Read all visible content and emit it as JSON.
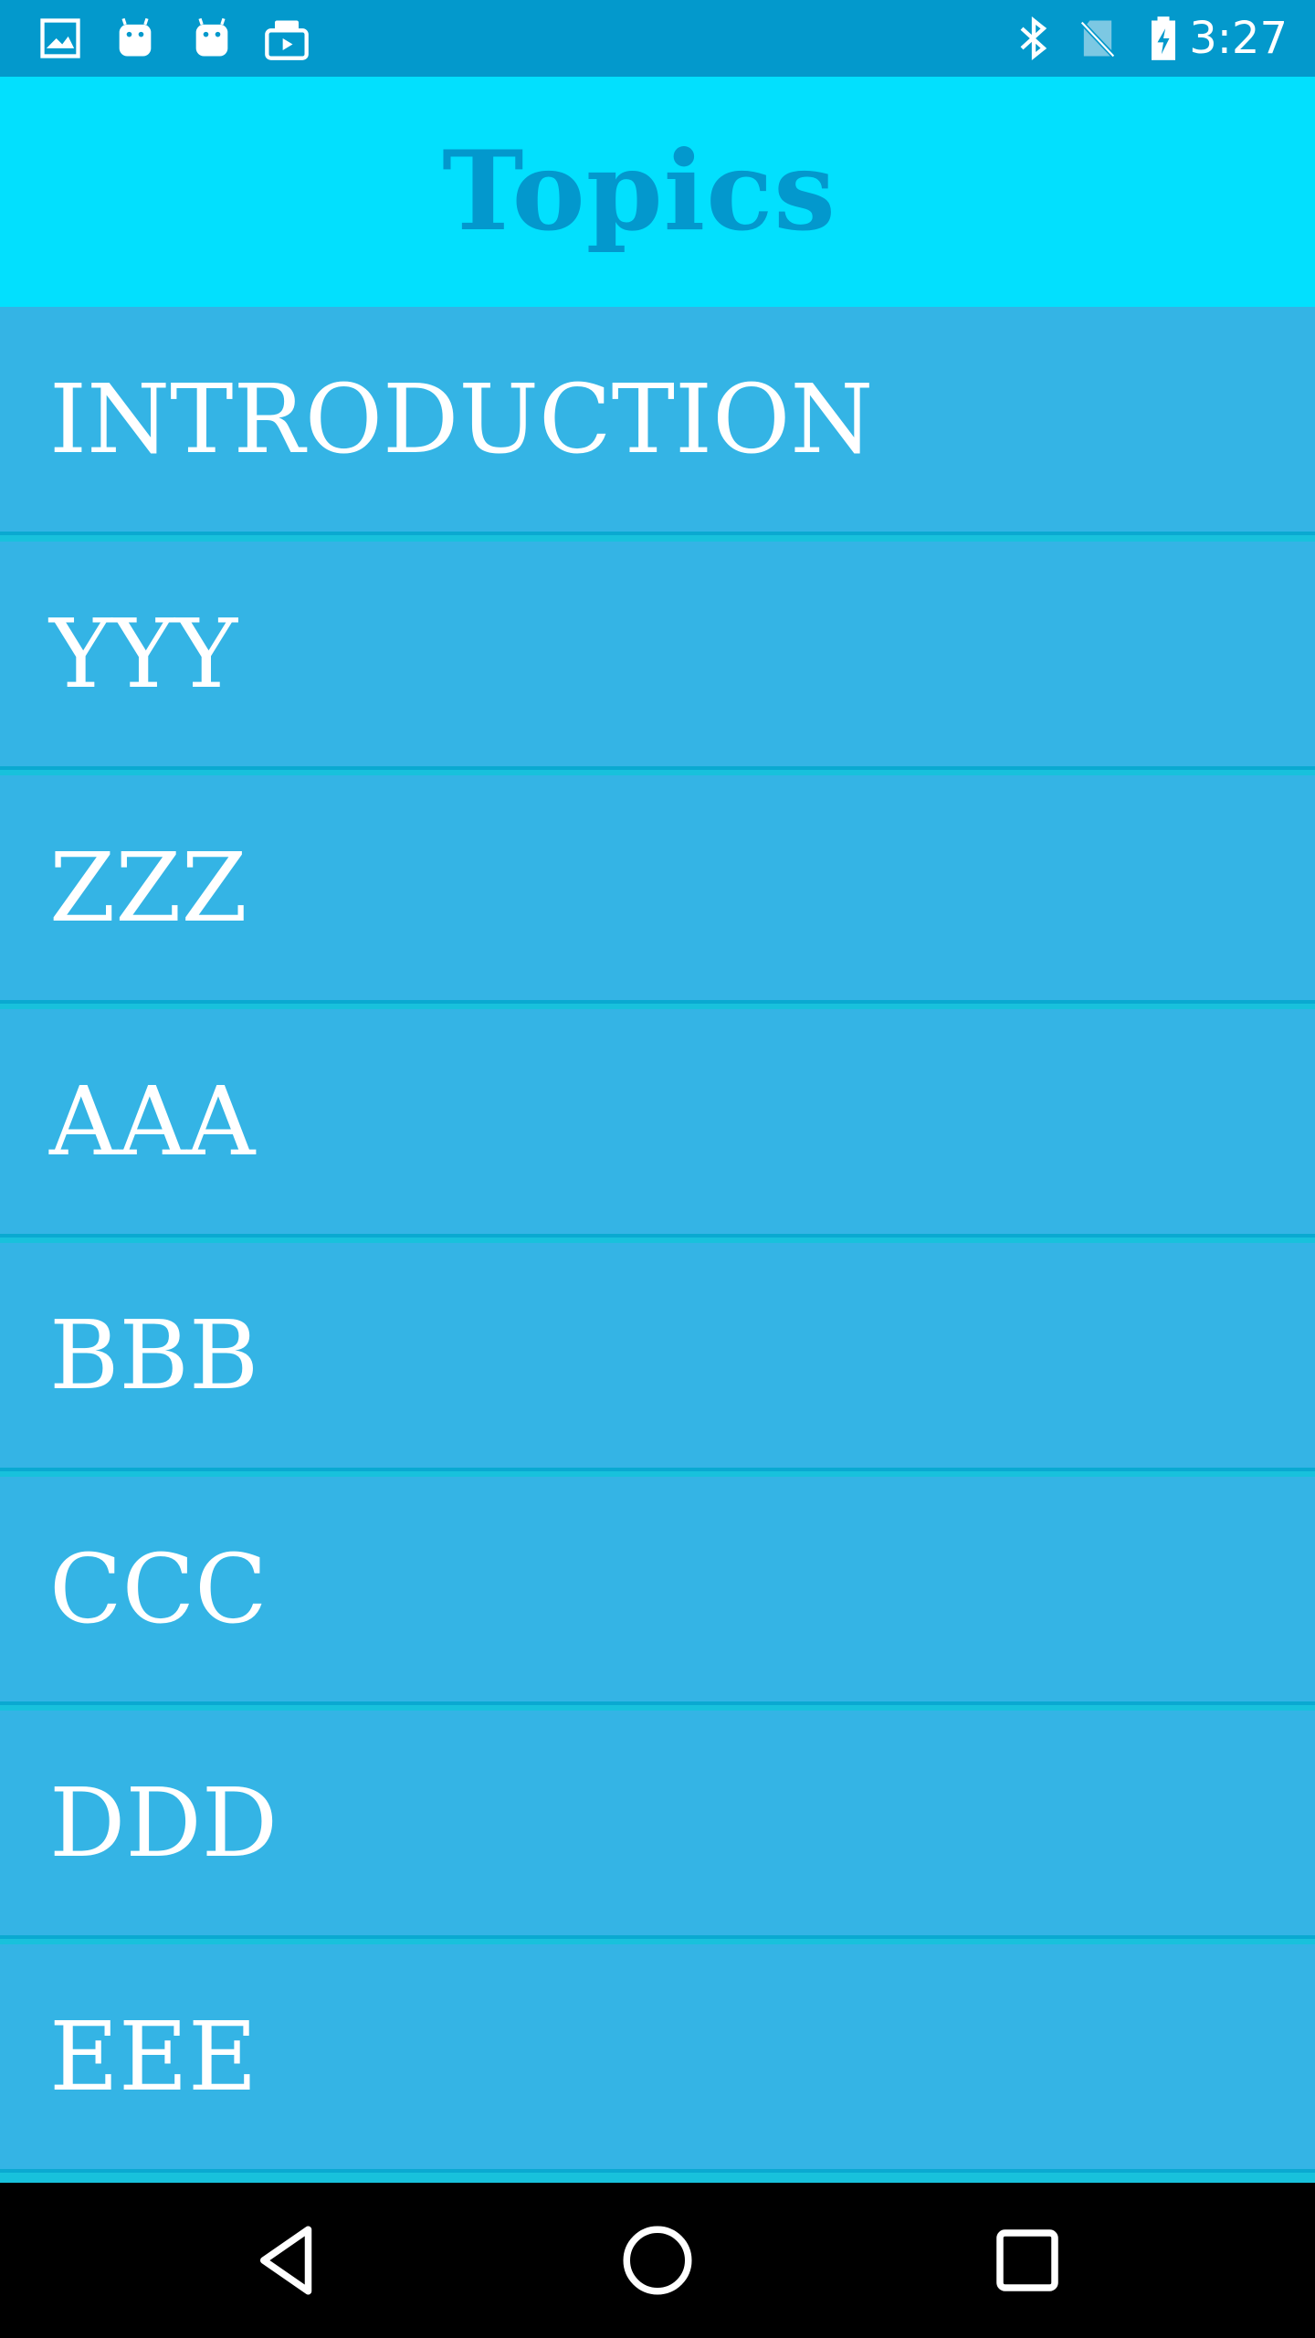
{
  "status_bar": {
    "time": "3:27",
    "left_icons": [
      "image-icon",
      "android-icon",
      "android-icon",
      "briefcase-icon"
    ],
    "right_icons": [
      "bluetooth-icon",
      "no-sim-icon",
      "battery-charging-icon"
    ]
  },
  "app_bar": {
    "title": "Topics"
  },
  "topics": [
    {
      "label": "INTRODUCTION"
    },
    {
      "label": "YYY"
    },
    {
      "label": "ZZZ"
    },
    {
      "label": "AAA"
    },
    {
      "label": "BBB"
    },
    {
      "label": "CCC"
    },
    {
      "label": "DDD"
    },
    {
      "label": "EEE"
    }
  ],
  "nav_bar": {
    "buttons": [
      "back-icon",
      "home-icon",
      "recents-icon"
    ]
  },
  "colors": {
    "status_bar": "#0399cc",
    "app_bar": "#02e0fe",
    "title_text": "#0398cd",
    "list_item": "#34b4e5",
    "list_divider": "#18c1dc",
    "nav_bar": "#000000"
  }
}
